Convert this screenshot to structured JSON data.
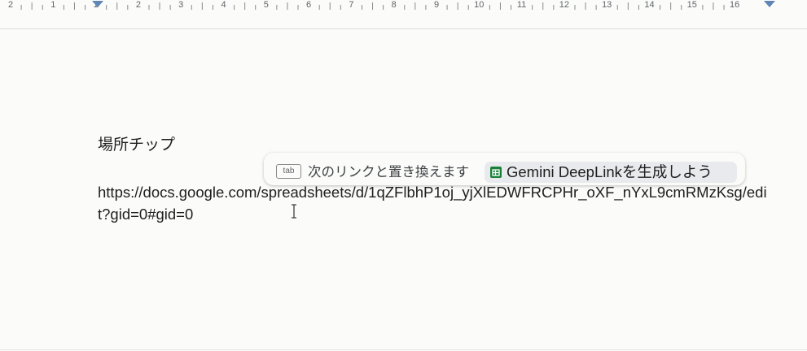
{
  "ruler": {
    "labels": [
      "2",
      "1",
      "1",
      "2",
      "3",
      "4",
      "5",
      "6",
      "7",
      "8",
      "9",
      "10",
      "11",
      "12",
      "13",
      "14",
      "15",
      "16"
    ]
  },
  "document": {
    "title": "場所チップ",
    "link_text": "https://docs.google.com/spreadsheets/d/1qZFlbhP1oj_yjXlEDWFRCPHr_oXF_nYxL9cmRMzKsg/edit?gid=0#gid=0"
  },
  "suggestion_chip": {
    "key_label": "tab",
    "hint_text": "次のリンクと置き換えます",
    "suggestion_label": "Gemini DeepLinkを生成しよう",
    "icon": "google-sheets-icon",
    "accent_color": "#188038"
  }
}
